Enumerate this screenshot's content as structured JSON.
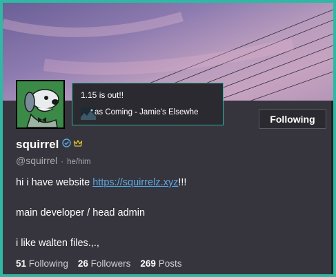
{
  "profile": {
    "display_name": "squirrel",
    "handle": "@squirrel",
    "separator": "·",
    "pronouns": "he/him",
    "follow_button_label": "Following",
    "accent_color": "#2fb8a3",
    "link_color": "#5aa9e6"
  },
  "status_tooltip": {
    "text": "1.15 is out!!",
    "now_playing": "as Coming - Jamie's Elsewhe"
  },
  "bio": {
    "line1_prefix": "hi i have website ",
    "line1_link": "https://squirrelz.xyz",
    "line1_suffix": "!!!",
    "line2": "main developer / head admin",
    "line3": "i like walten files.,.,"
  },
  "stats": {
    "following_count": "51",
    "following_label": "Following",
    "followers_count": "26",
    "followers_label": "Followers",
    "posts_count": "269",
    "posts_label": "Posts"
  },
  "icons": {
    "verified": "verified-badge-icon",
    "crown": "crown-icon"
  }
}
